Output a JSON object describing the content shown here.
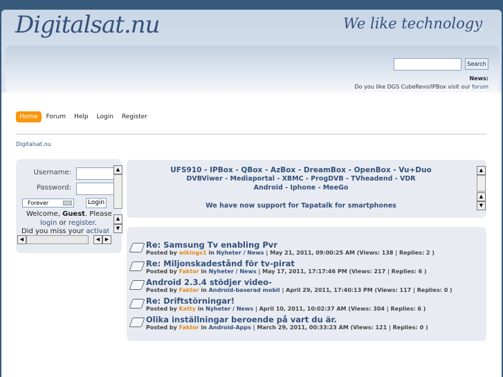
{
  "header": {
    "logo": "Digitalsat.nu",
    "slogan": "We like technology",
    "search_placeholder": "",
    "search_button": "Search",
    "news_label": "News:",
    "news_text": "Do you like DGS CubeRevo/IPBox visit our ",
    "news_link": "forum"
  },
  "nav": [
    "Home",
    "Forum",
    "Help",
    "Login",
    "Register"
  ],
  "breadcrumb": "Digitalsat.nu",
  "login": {
    "username_label": "Username:",
    "password_label": "Password:",
    "duration": "Forever",
    "login_button": "Login",
    "welcome_pre": "Welcome, ",
    "guest": "Guest",
    "welcome_post": ". Please",
    "login_link": "login",
    "or": " or ",
    "register_link": "register",
    "dot": ".",
    "missed": "Did you miss your ",
    "activation": "activation"
  },
  "ticker": {
    "line1": "UFS910 - IPBox - QBox - AzBox - DreamBox - OpenBox - Vu+Duo",
    "line2": "DVBViwer - Mediaportal - XBMC - ProgDVB - TVheadend - VDR",
    "line3": "Android - Iphone - MeeGo",
    "line4": "We have now support for Tapatalk for smartphones"
  },
  "posts": [
    {
      "title": "Re: Samsung Tv enabling Pvr",
      "by": "Posted by ",
      "user": "wikings1",
      "in": " in ",
      "board": "Nyheter / News",
      "info": " | May 21, 2011, 09:00:25 AM (Views: 138 | Replies: 2 )"
    },
    {
      "title": "Re: Miljonskadestånd för tv-pirat",
      "by": "Posted by ",
      "user": "Faktor",
      "in": " in ",
      "board": "Nyheter / News",
      "info": " | May 17, 2011, 17:17:46 PM (Views: 217 | Replies: 6 )"
    },
    {
      "title": "Android 2.3.4 stödjer video-",
      "by": "Posted by ",
      "user": "Faktor",
      "in": " in ",
      "board": "Android-baserad mobil",
      "info": " | April 29, 2011, 17:40:13 PM (Views: 117 | Replies: 0 )"
    },
    {
      "title": "Re: Driftstörningar!",
      "by": "Posted by ",
      "user": "Katty",
      "in": " in ",
      "board": "Nyheter / News",
      "info": " | April 10, 2011, 10:02:37 AM (Views: 304 | Replies: 6 )"
    },
    {
      "title": "Olika inställningar beroende på vart du är.",
      "by": "Posted by ",
      "user": "Faktor",
      "in": " in ",
      "board": "Android-Apps",
      "info": " | March 29, 2011, 00:33:23 AM (Views: 121 | Replies: 0 )"
    }
  ]
}
